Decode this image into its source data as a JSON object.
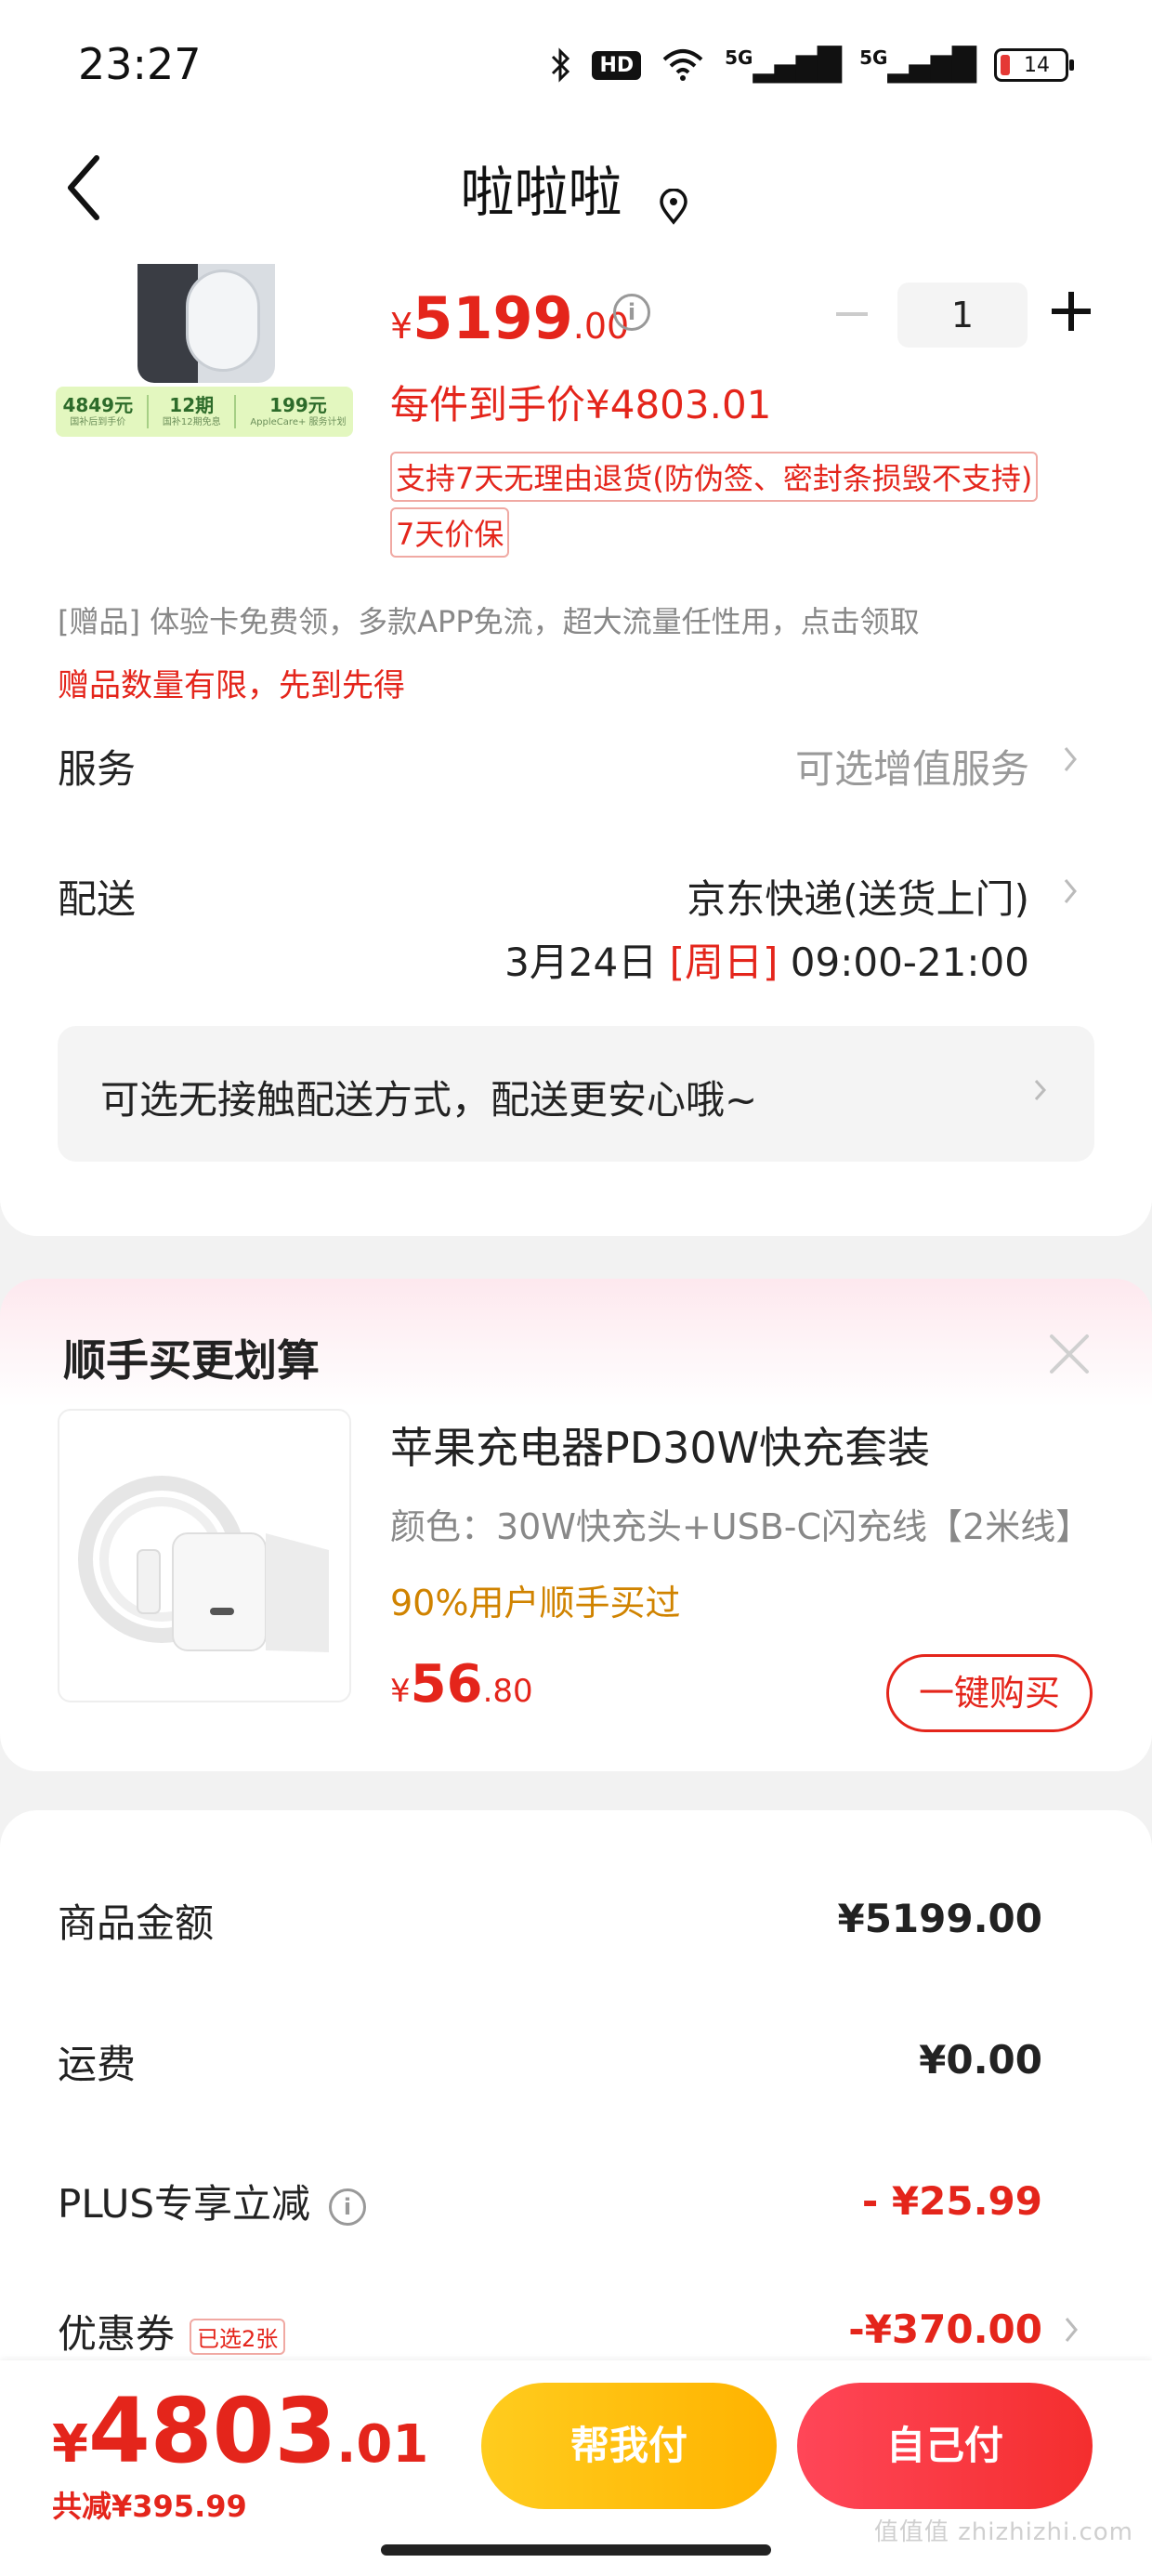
{
  "status_bar": {
    "time": "23:27",
    "icons": [
      "bluetooth-icon",
      "hd-icon",
      "wifi-icon",
      "5g-signal-icon",
      "5g-signal-icon",
      "battery-icon"
    ],
    "hd_label": "HD",
    "signal1": "5G",
    "signal2": "5G",
    "battery": "14"
  },
  "header": {
    "title": "啦啦啦"
  },
  "product": {
    "promo": [
      {
        "value": "4849元",
        "sub": "国补后到手价"
      },
      {
        "value": "12期",
        "sub": "国补12期免息"
      },
      {
        "value": "199元",
        "sub": "AppleCare+ 服务计划"
      }
    ],
    "price_yen": "¥",
    "price_int": "5199",
    "price_dec": ".00",
    "info": "i",
    "quantity": "1",
    "unit_price": "每件到手价¥4803.01",
    "tags": [
      "支持7天无理由退货(防伪签、密封条损毁不支持)",
      "7天价保"
    ]
  },
  "gift": {
    "line": "[赠品]  体验卡免费领，多款APP免流，超大流量任性用，点击领取",
    "note": "赠品数量有限，先到先得"
  },
  "service": {
    "label": "服务",
    "value": "可选增值服务"
  },
  "shipping": {
    "label": "配送",
    "value": "京东快递(送货上门)",
    "date": "3月24日 ",
    "weekday": "[周日]",
    "time": " 09:00-21:00"
  },
  "contactless": {
    "text": "可选无接触配送方式，配送更安心哦~"
  },
  "addon": {
    "title": "顺手买更划算",
    "name": "苹果充电器PD30W快充套装",
    "spec": "颜色：30W快充头+USB-C闪充线【2米线】",
    "social": "90%用户顺手买过",
    "price_yen": "¥",
    "price_int": "56",
    "price_dec": ".80",
    "buy": "一键购买"
  },
  "summary": {
    "rows": [
      {
        "label": "商品金额",
        "value": "¥5199.00"
      },
      {
        "label": "运费",
        "value": "¥0.00"
      },
      {
        "label": "PLUS专享立减",
        "value": "- ¥25.99"
      },
      {
        "label": "优惠券",
        "badge": "已选2张",
        "value": "-¥370.00"
      }
    ]
  },
  "bottom": {
    "total_yen": "¥",
    "total_int": "4803",
    "total_dec": ".01",
    "saving": "共减¥395.99",
    "help_pay": "帮我付",
    "self_pay": "自己付"
  },
  "watermark": "值值值 zhizhizhi.com",
  "colors": {
    "accent_red": "#e4251b",
    "help_yellow": "#ffcc1e",
    "pay_red": "#f42e2e",
    "social_orange": "#d08300"
  }
}
